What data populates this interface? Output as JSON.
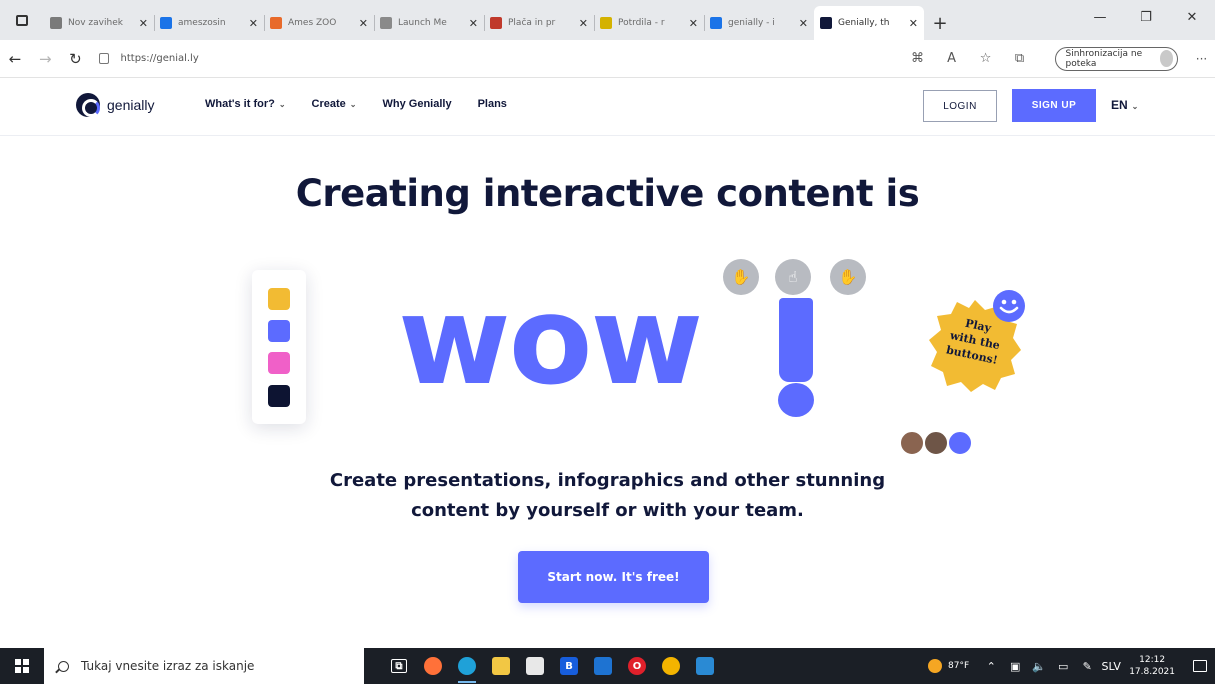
{
  "browser": {
    "tabs": [
      {
        "title": "Nov zavihek",
        "favicon_color": "#7a7a7a"
      },
      {
        "title": "ameszosin",
        "favicon_color": "#1a73e8"
      },
      {
        "title": "Ames ZOO",
        "favicon_color": "#e86a2a"
      },
      {
        "title": "Launch Me",
        "favicon_color": "#8a8a8a"
      },
      {
        "title": "Plača in pr",
        "favicon_color": "#c0392b"
      },
      {
        "title": "Potrdila - r",
        "favicon_color": "#d4b200"
      },
      {
        "title": "genially - i",
        "favicon_color": "#1a73e8"
      },
      {
        "title": "Genially, th",
        "favicon_color": "#11183a"
      }
    ],
    "active_tab_index": 7,
    "url": "https://genial.ly",
    "sync_label": "Sinhronizacija ne poteka"
  },
  "site": {
    "brand": "genially",
    "nav": [
      {
        "label": "What's it for?",
        "dropdown": true
      },
      {
        "label": "Create",
        "dropdown": true
      },
      {
        "label": "Why Genially",
        "dropdown": false
      },
      {
        "label": "Plans",
        "dropdown": false
      }
    ],
    "login_label": "LOGIN",
    "signup_label": "SIGN UP",
    "language": "EN"
  },
  "hero": {
    "title": "Creating interactive content is",
    "word": "wow",
    "badge_lines": [
      "Play",
      "with the",
      "buttons!"
    ],
    "subtitle_line1": "Create presentations, infographics and other stunning",
    "subtitle_line2": "content by yourself or with your team.",
    "cta_label": "Start now. It's free!",
    "palette_colors": [
      "#f2bb33",
      "#5c6bff",
      "#f060c8",
      "#0d1432"
    ]
  },
  "taskbar": {
    "search_placeholder": "Tukaj vnesite izraz za iskanje",
    "apps": [
      {
        "name": "task-view",
        "color": "#1b1f26",
        "glyph": "⧉"
      },
      {
        "name": "firefox",
        "color": "#ff7139",
        "glyph": ""
      },
      {
        "name": "edge",
        "color": "#1fa1d8",
        "glyph": ""
      },
      {
        "name": "file-explorer",
        "color": "#f2c744",
        "glyph": ""
      },
      {
        "name": "store",
        "color": "#e8e8e8",
        "glyph": ""
      },
      {
        "name": "bitwarden",
        "color": "#175ddc",
        "glyph": "B"
      },
      {
        "name": "mail",
        "color": "#1e73d2",
        "glyph": ""
      },
      {
        "name": "opera",
        "color": "#e0202b",
        "glyph": "O"
      },
      {
        "name": "chrome",
        "color": "#f4b400",
        "glyph": ""
      },
      {
        "name": "photos",
        "color": "#2a8ad4",
        "glyph": ""
      }
    ],
    "weather": "87°F",
    "language": "SLV",
    "time": "12:12",
    "date": "17.8.2021"
  }
}
